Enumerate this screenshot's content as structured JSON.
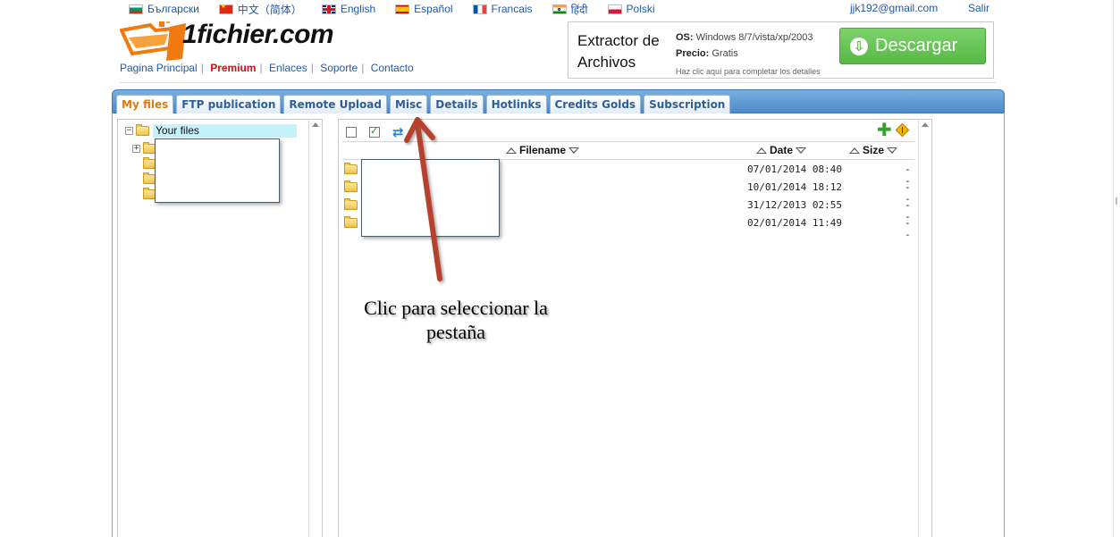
{
  "languages": [
    {
      "label": "Български",
      "flag": "bg"
    },
    {
      "label": "中文（简体）",
      "flag": "cn"
    },
    {
      "label": "English",
      "flag": "gb"
    },
    {
      "label": "Español",
      "flag": "es"
    },
    {
      "label": "Francais",
      "flag": "fr"
    },
    {
      "label": "हिंदी",
      "flag": "in"
    },
    {
      "label": "Polski",
      "flag": "pl"
    }
  ],
  "user": {
    "email": "jjk192@gmail.com",
    "logout_label": "Salir"
  },
  "logo": {
    "text": "1fichier.com"
  },
  "nav": {
    "home": "Pagina Principal",
    "premium": "Premium",
    "links": "Enlaces",
    "support": "Soporte",
    "contact": "Contacto",
    "separator": "|"
  },
  "ad": {
    "title": "Extractor de Archivos",
    "os_label": "OS:",
    "os_value": "Windows 8/7/vista/xp/2003",
    "price_label": "Precio:",
    "price_value": "Gratis",
    "hint": "Haz clic aquí para completar los detalles",
    "button_label": "Descargar"
  },
  "tabs": [
    {
      "label": "My files",
      "active": true
    },
    {
      "label": "FTP publication",
      "active": false
    },
    {
      "label": "Remote Upload",
      "active": false
    },
    {
      "label": "Misc",
      "active": false
    },
    {
      "label": "Details",
      "active": false
    },
    {
      "label": "Hotlinks",
      "active": false
    },
    {
      "label": "Credits Golds",
      "active": false
    },
    {
      "label": "Subscription",
      "active": false
    }
  ],
  "tree": {
    "root_label": "Your files",
    "expand_symbol": "−",
    "child_expand_symbol": "+"
  },
  "file_list": {
    "columns": {
      "filename": "Filename",
      "date": "Date",
      "size": "Size"
    },
    "rows": [
      {
        "date": "07/01/2014 08:40",
        "size": "--"
      },
      {
        "date": "10/01/2014 18:12",
        "size": "--"
      },
      {
        "date": "31/12/2013 02:55",
        "size": "--"
      },
      {
        "date": "02/01/2014 11:49",
        "size": "--"
      }
    ]
  },
  "annotation": {
    "line1": "Clic para seleccionar la",
    "line2": "pestaña"
  },
  "colors": {
    "accent": "#2158a8",
    "active_tab": "#e07a10",
    "premium": "#cc1111",
    "download": "#58b845",
    "arrow": "#b5432e"
  }
}
